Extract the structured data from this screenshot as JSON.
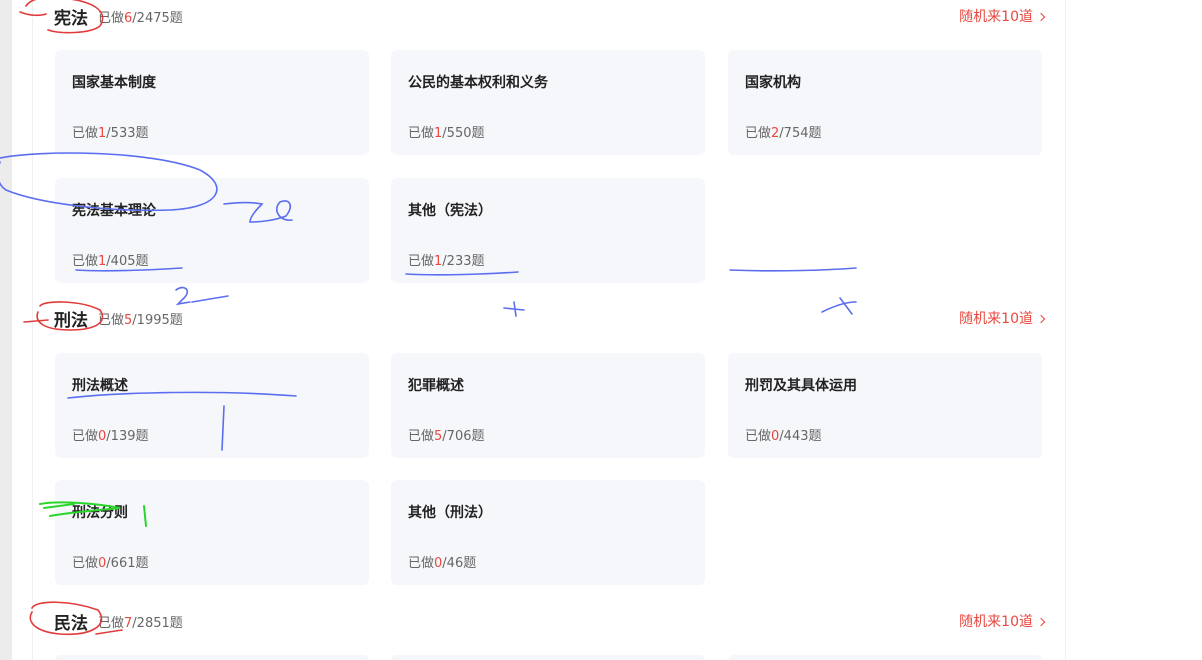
{
  "sections": [
    {
      "title": "宪法",
      "progress_prefix": "已做",
      "done": "6",
      "total_suffix": "/2475题",
      "random_label": "随机来10道",
      "cards": [
        {
          "title": "国家基本制度",
          "prefix": "已做",
          "done": "1",
          "suffix": "/533题"
        },
        {
          "title": "公民的基本权利和义务",
          "prefix": "已做",
          "done": "1",
          "suffix": "/550题"
        },
        {
          "title": "国家机构",
          "prefix": "已做",
          "done": "2",
          "suffix": "/754题"
        },
        {
          "title": "宪法基本理论",
          "prefix": "已做",
          "done": "1",
          "suffix": "/405题"
        },
        {
          "title": "其他（宪法）",
          "prefix": "已做",
          "done": "1",
          "suffix": "/233题"
        }
      ]
    },
    {
      "title": "刑法",
      "progress_prefix": "已做",
      "done": "5",
      "total_suffix": "/1995题",
      "random_label": "随机来10道",
      "cards": [
        {
          "title": "刑法概述",
          "prefix": "已做",
          "done": "0",
          "suffix": "/139题"
        },
        {
          "title": "犯罪概述",
          "prefix": "已做",
          "done": "5",
          "suffix": "/706题"
        },
        {
          "title": "刑罚及其具体运用",
          "prefix": "已做",
          "done": "0",
          "suffix": "/443题"
        },
        {
          "title": "刑法分则",
          "prefix": "已做",
          "done": "0",
          "suffix": "/661题"
        },
        {
          "title": "其他（刑法）",
          "prefix": "已做",
          "done": "0",
          "suffix": "/46题"
        }
      ]
    },
    {
      "title": "民法",
      "progress_prefix": "已做",
      "done": "7",
      "total_suffix": "/2851题",
      "random_label": "随机来10道",
      "cards": []
    }
  ],
  "colors": {
    "accent": "#e8483f",
    "card_bg": "#f6f7fa",
    "annotation_blue": "#5b6ef0",
    "annotation_red": "#e23b3b",
    "annotation_green": "#2bd62b"
  }
}
